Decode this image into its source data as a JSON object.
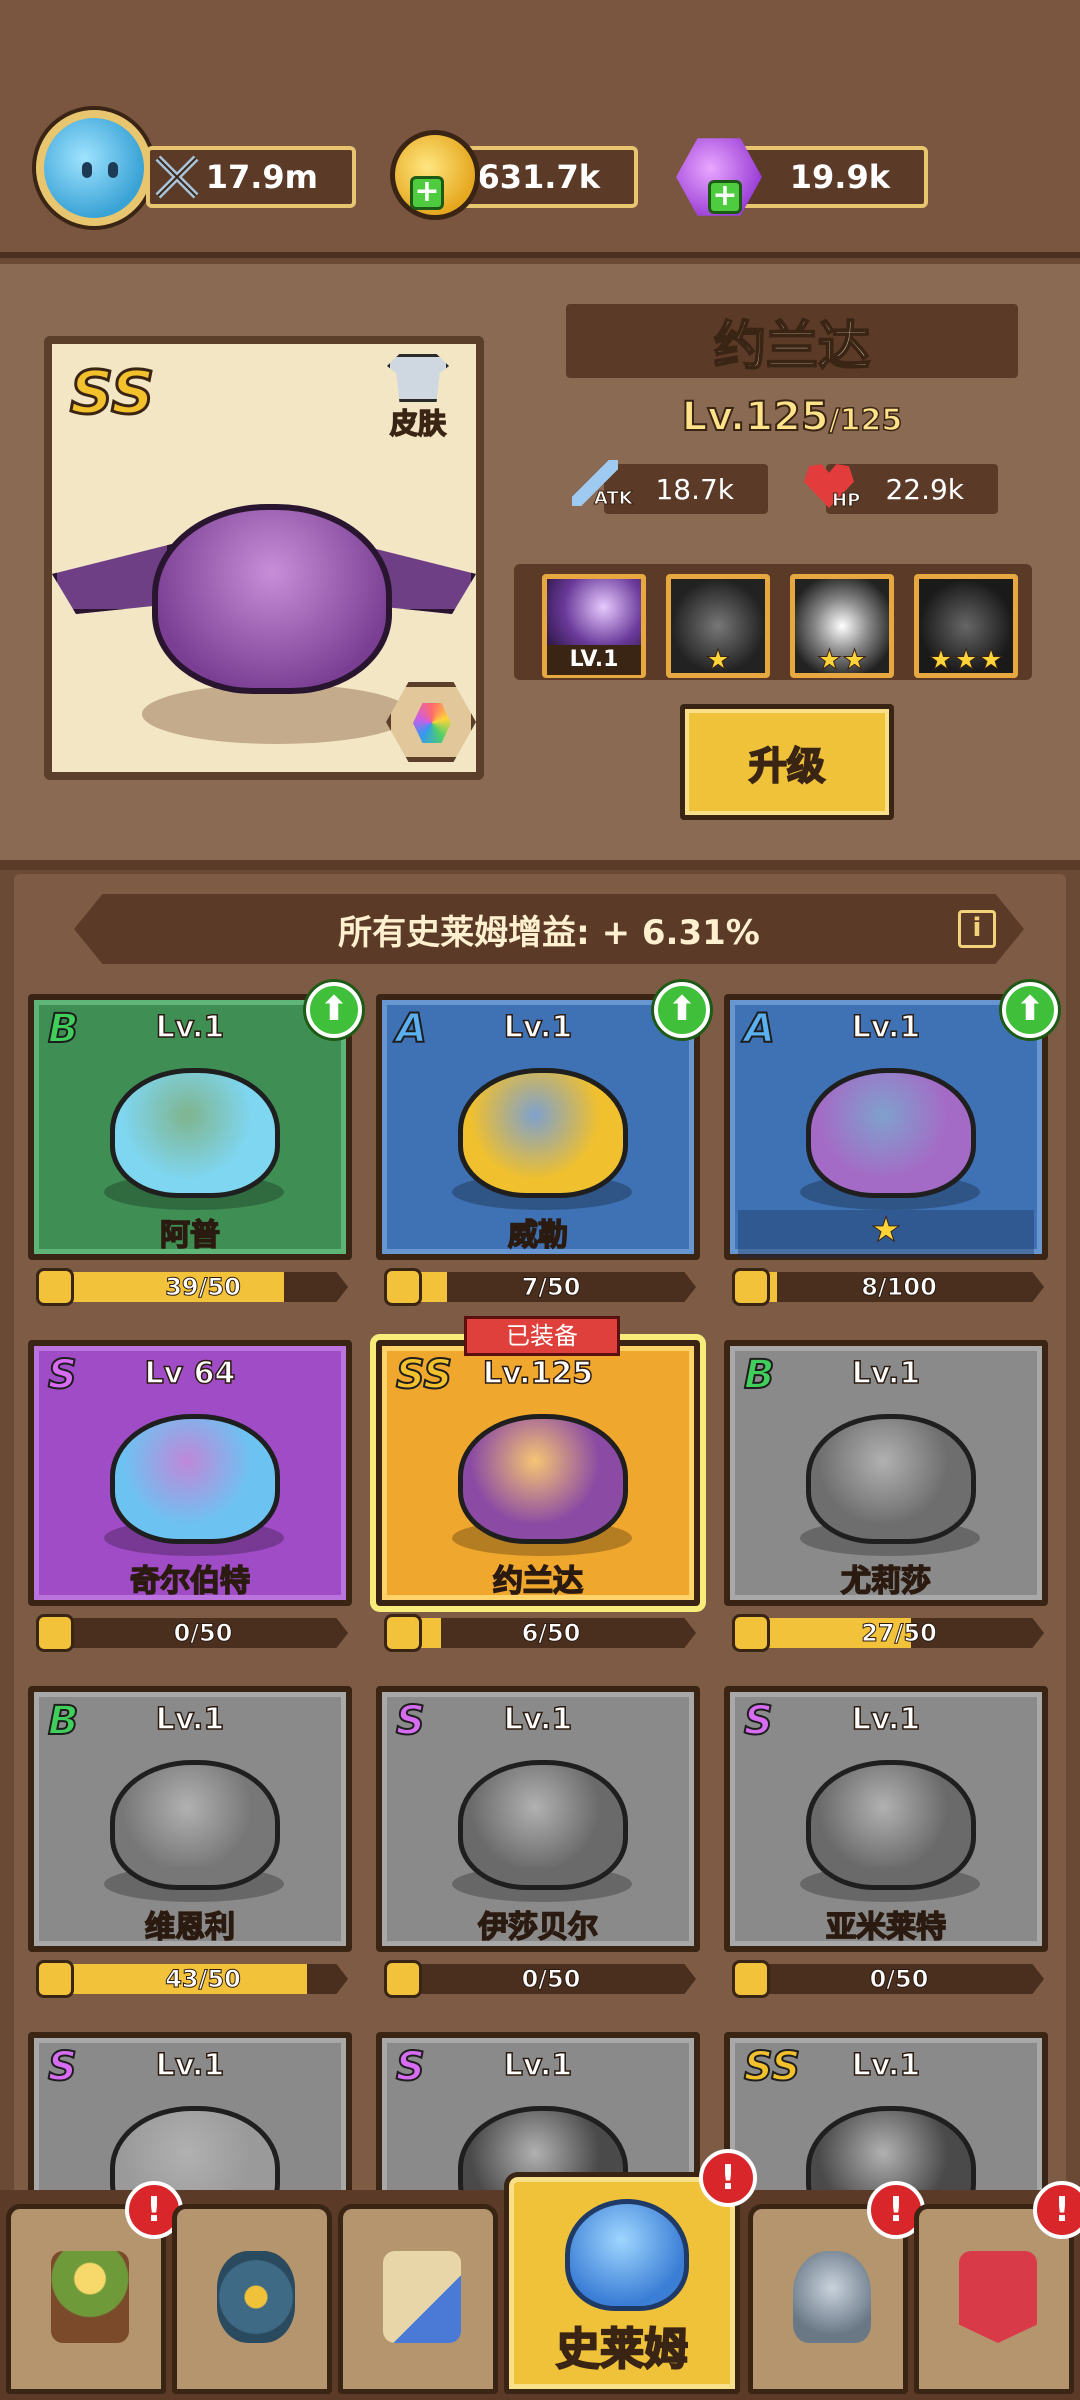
{
  "currency": {
    "power": "17.9m",
    "coins": "631.7k",
    "gems": "19.9k"
  },
  "hero": {
    "rank": "SS",
    "skin_label": "皮肤",
    "name": "约兰达",
    "level": "Lv.125",
    "level_max": "/125",
    "atk_label": "ATK",
    "atk": "18.7k",
    "hp_label": "HP",
    "hp": "22.9k",
    "skills": [
      {
        "badge": "LV.1",
        "stars": ""
      },
      {
        "badge": "",
        "stars": "★"
      },
      {
        "badge": "",
        "stars": "★★"
      },
      {
        "badge": "",
        "stars": "★★★"
      }
    ],
    "upgrade_label": "升级"
  },
  "bonus": {
    "text": "所有史莱姆增益: + 6.31%",
    "info": "i"
  },
  "slimes": [
    {
      "rank": "B",
      "level": "Lv.1",
      "name": "阿普",
      "progress": "39/50",
      "fill": 0.78,
      "color": "green",
      "slime": "#7fd6f0",
      "upgrade": true
    },
    {
      "rank": "A",
      "level": "Lv.1",
      "name": "威勒",
      "progress": "7/50",
      "fill": 0.14,
      "color": "blue",
      "slime": "#f0c02e",
      "upgrade": true
    },
    {
      "rank": "A",
      "level": "Lv.1",
      "name": "",
      "progress": "8/100",
      "fill": 0.08,
      "color": "blue",
      "slime": "#a46bc6",
      "upgrade": true,
      "star": "★"
    },
    {
      "rank": "S",
      "level": "Lv 64",
      "name": "奇尔伯特",
      "progress": "0/50",
      "fill": 0,
      "color": "purple",
      "slime": "#6cc3f2",
      "upgrade": false
    },
    {
      "rank": "SS",
      "level": "Lv.125",
      "name": "约兰达",
      "progress": "6/50",
      "fill": 0.12,
      "color": "gold",
      "slime": "#8b4aa4",
      "upgrade": false,
      "equipped": "已装备"
    },
    {
      "rank": "B",
      "level": "Lv.1",
      "name": "尤莉莎",
      "progress": "27/50",
      "fill": 0.54,
      "color": "gray",
      "slime": "#6e6e6e",
      "upgrade": false
    },
    {
      "rank": "B",
      "level": "Lv.1",
      "name": "维恩利",
      "progress": "43/50",
      "fill": 0.86,
      "color": "gray",
      "slime": "#777777",
      "upgrade": false
    },
    {
      "rank": "S",
      "level": "Lv.1",
      "name": "伊莎贝尔",
      "progress": "0/50",
      "fill": 0,
      "color": "gray",
      "slime": "#6a6a6a",
      "upgrade": false
    },
    {
      "rank": "S",
      "level": "Lv.1",
      "name": "亚米莱特",
      "progress": "0/50",
      "fill": 0,
      "color": "gray",
      "slime": "#6a6a6a",
      "upgrade": false
    },
    {
      "rank": "S",
      "level": "Lv.1",
      "name": "",
      "progress": "",
      "fill": 0,
      "color": "gray",
      "slime": "#9a9a9a",
      "upgrade": false
    },
    {
      "rank": "S",
      "level": "Lv.1",
      "name": "",
      "progress": "",
      "fill": 0,
      "color": "gray",
      "slime": "#4a4a4a",
      "upgrade": false
    },
    {
      "rank": "SS",
      "level": "Lv.1",
      "name": "",
      "progress": "",
      "fill": 0,
      "color": "gray",
      "slime": "#4a4a4a",
      "upgrade": false
    }
  ],
  "nav": [
    {
      "icon": "hero-icon",
      "label": "",
      "alert": "!"
    },
    {
      "icon": "rune-icon",
      "label": "",
      "alert": ""
    },
    {
      "icon": "scroll-icon",
      "label": "",
      "alert": ""
    },
    {
      "icon": "slime-icon",
      "label": "史莱姆",
      "alert": "!"
    },
    {
      "icon": "helmet-icon",
      "label": "",
      "alert": "!"
    },
    {
      "icon": "banner-icon",
      "label": "",
      "alert": "!"
    }
  ],
  "colors": {
    "rank_B": "#3fcf5a",
    "rank_A": "#5bb0f2",
    "rank_S": "#d86cf2",
    "rank_SS": "#f3c12c"
  }
}
